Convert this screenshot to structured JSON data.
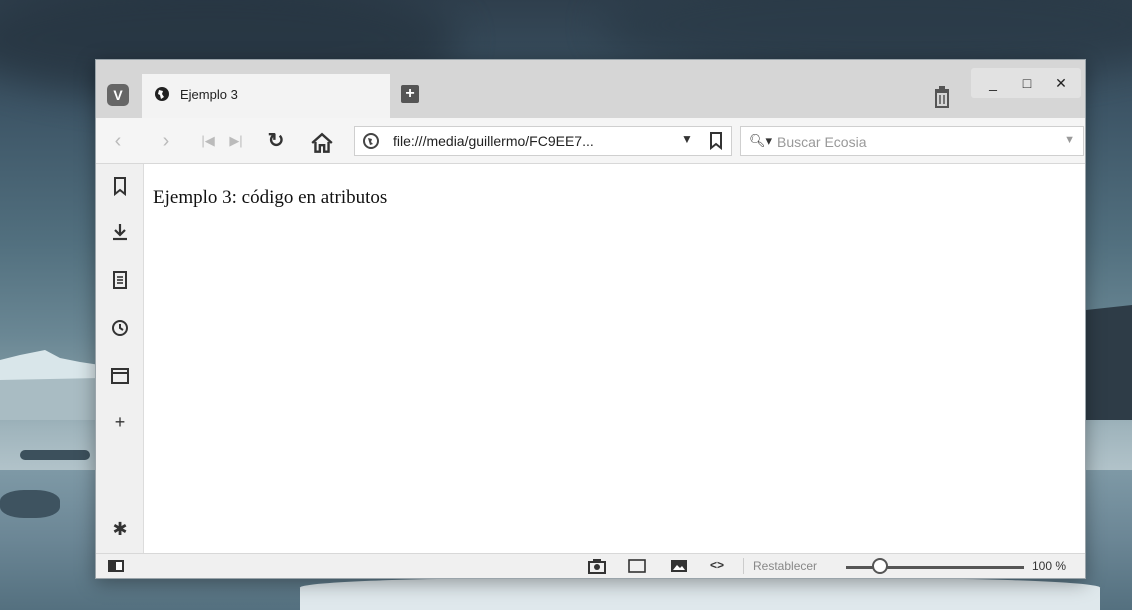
{
  "browser": {
    "tab": {
      "title": "Ejemplo 3"
    },
    "window_controls": {
      "minimize": "_",
      "maximize": "□",
      "close": "✕"
    },
    "address": {
      "url": "file:///media/guillermo/FC9EE7..."
    },
    "search": {
      "placeholder": "Buscar Ecosia"
    },
    "page": {
      "text": "Ejemplo 3: código en atributos"
    },
    "status": {
      "reset_label": "Restablecer",
      "zoom": "100 %"
    },
    "zoom_level_fraction": 0.15
  },
  "colors": {
    "titlebar": "#d6d6d6",
    "tab_active": "#f3f3f3",
    "toolbar": "#f5f5f5"
  }
}
